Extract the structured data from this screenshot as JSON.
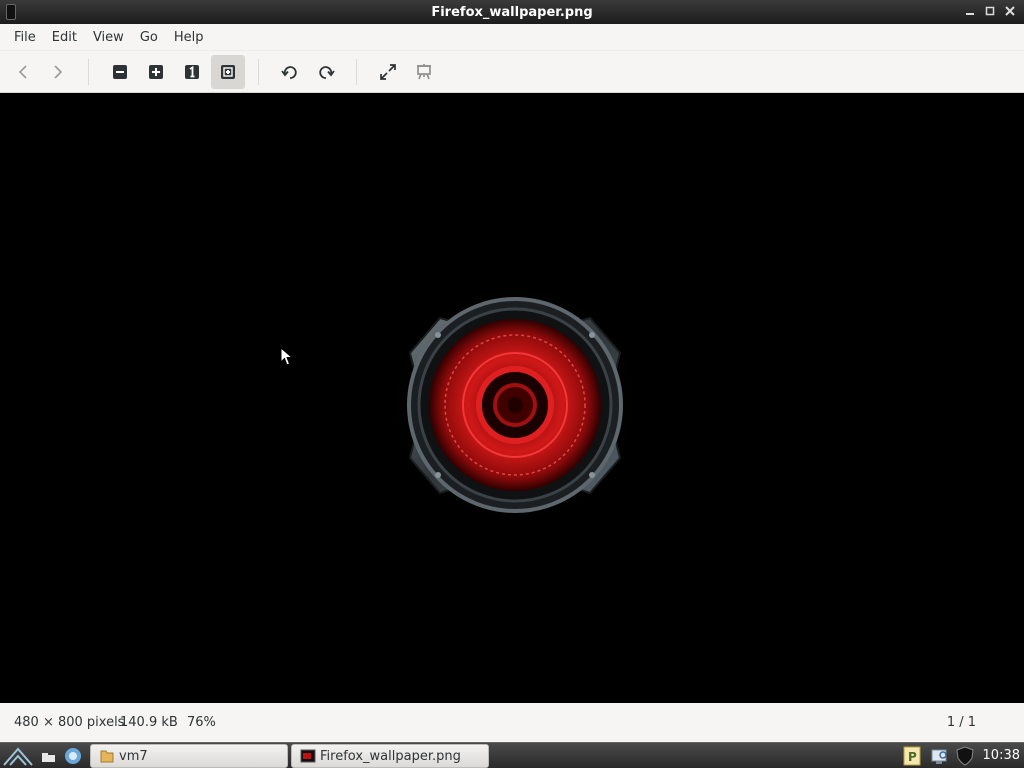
{
  "window": {
    "title": "Firefox_wallpaper.png"
  },
  "menu": {
    "items": [
      "File",
      "Edit",
      "View",
      "Go",
      "Help"
    ]
  },
  "toolbar": {
    "buttons": [
      {
        "name": "previous-button",
        "icon": "chevron-left-icon"
      },
      {
        "name": "next-button",
        "icon": "chevron-right-icon"
      },
      {
        "name": "zoom-out-button",
        "icon": "zoom-out-icon"
      },
      {
        "name": "zoom-in-button",
        "icon": "zoom-in-icon"
      },
      {
        "name": "zoom-original-button",
        "icon": "one-to-one-icon"
      },
      {
        "name": "zoom-fit-button",
        "icon": "fit-window-icon",
        "active": true
      },
      {
        "name": "rotate-left-button",
        "icon": "rotate-ccw-icon"
      },
      {
        "name": "rotate-right-button",
        "icon": "rotate-cw-icon"
      },
      {
        "name": "fullscreen-button",
        "icon": "expand-icon"
      },
      {
        "name": "slideshow-button",
        "icon": "easel-icon"
      }
    ]
  },
  "status": {
    "dimensions": "480 × 800 pixels",
    "filesize": "140.9 kB",
    "zoom": "76%",
    "pager": "1 / 1"
  },
  "taskbar": {
    "tasks": [
      {
        "label": "vm7",
        "icon": "folder-icon"
      },
      {
        "label": "Firefox_wallpaper.png",
        "icon": "image-icon"
      }
    ],
    "clock": "10:38"
  },
  "colors": {
    "accent_red": "#d01818",
    "chrome_bg": "#f6f5f4",
    "viewer_bg": "#000000"
  }
}
